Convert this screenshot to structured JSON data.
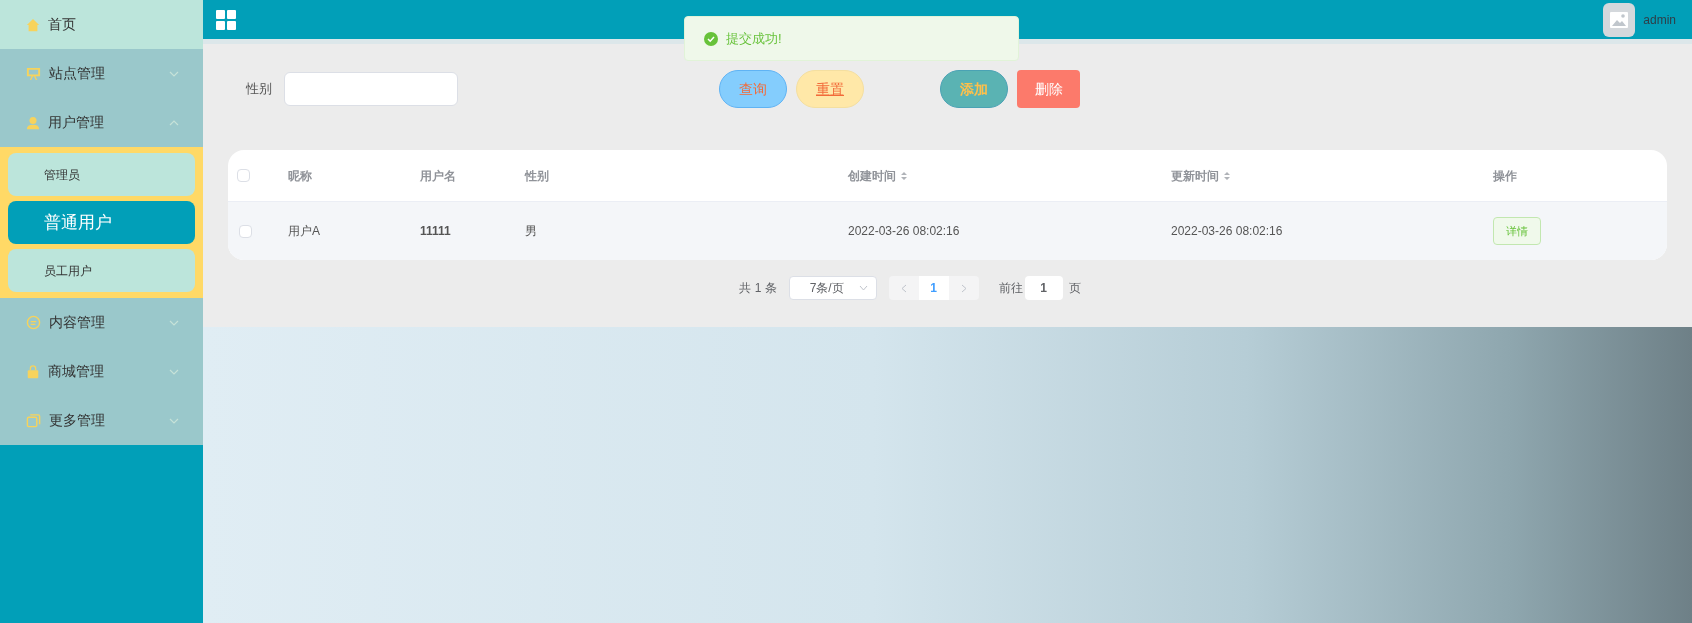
{
  "sidebar": {
    "items": [
      {
        "label": "首页",
        "kind": "home",
        "selected": true
      },
      {
        "label": "站点管理",
        "kind": "site",
        "expanded": false,
        "selected": false
      },
      {
        "label": "用户管理",
        "kind": "user",
        "expanded": true,
        "selected": false,
        "children": [
          {
            "label": "管理员",
            "selected": false
          },
          {
            "label": "普通用户",
            "selected": true
          },
          {
            "label": "员工用户",
            "selected": false
          }
        ]
      },
      {
        "label": "内容管理",
        "kind": "chat",
        "expanded": false,
        "selected": false
      },
      {
        "label": "商城管理",
        "kind": "bag",
        "expanded": false,
        "selected": false
      },
      {
        "label": "更多管理",
        "kind": "copy",
        "expanded": false,
        "selected": false
      }
    ]
  },
  "header": {
    "user": "admin"
  },
  "toast": {
    "message": "提交成功!"
  },
  "search": {
    "label": "性别",
    "buttons": [
      {
        "label": "查询",
        "kind": "query"
      },
      {
        "label": "重置",
        "kind": "reset"
      },
      {
        "label": "添加",
        "kind": "add"
      },
      {
        "label": "删除",
        "kind": "delete"
      }
    ]
  },
  "table": {
    "select_all_checked": false,
    "columns": [
      {
        "label": "昵称",
        "sortable": false
      },
      {
        "label": "用户名",
        "sortable": false
      },
      {
        "label": "性别",
        "sortable": false
      },
      {
        "label": "创建时间",
        "sortable": true
      },
      {
        "label": "更新时间",
        "sortable": true
      },
      {
        "label": "操作",
        "sortable": false
      }
    ],
    "rows": [
      {
        "checked": false,
        "cells": [
          "用户A",
          "11111",
          "男",
          "2022-03-26 08:02:16",
          "2022-03-26 08:02:16"
        ],
        "action": "详情"
      }
    ]
  },
  "pagination": {
    "total": "共 1 条",
    "page_size": "7条/页",
    "pages": [
      {
        "label": "1",
        "selected": true
      }
    ],
    "goto_label": "前往",
    "goto_value": "1",
    "goto_suffix": "页"
  }
}
